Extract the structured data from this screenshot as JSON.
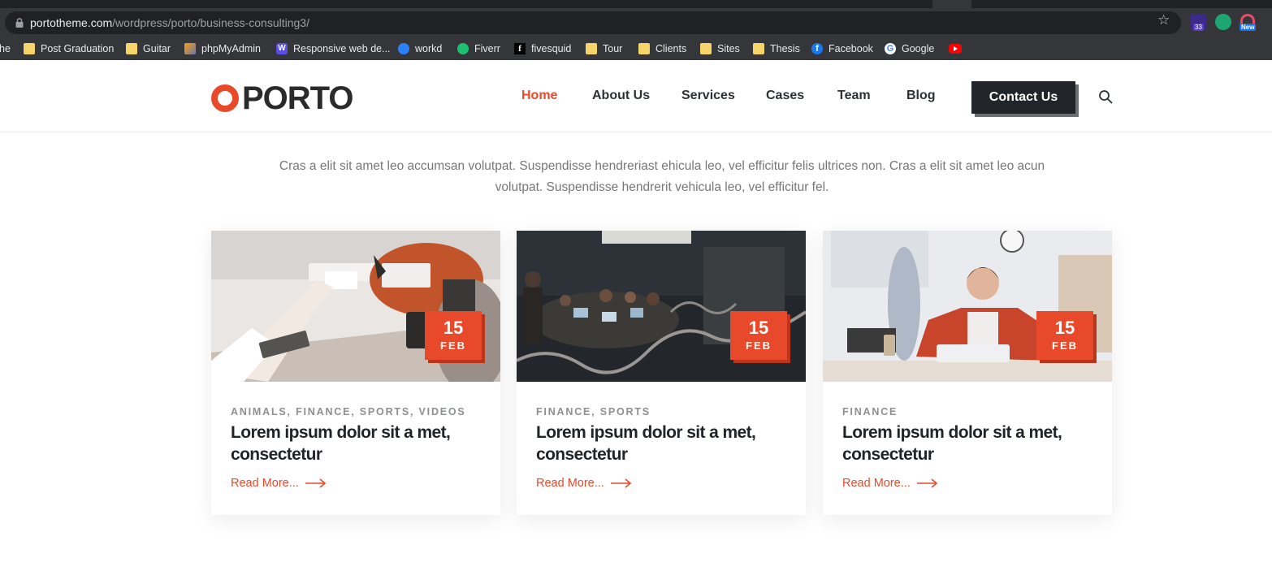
{
  "browser": {
    "url_host": "portotheme.com",
    "url_path": "/wordpress/porto/business-consulting3/",
    "ext_badge": "33",
    "ext_new": "New",
    "bookmarks": [
      {
        "label": "he",
        "icon": "none"
      },
      {
        "label": "Post Graduation",
        "icon": "folder-icon"
      },
      {
        "label": "Guitar",
        "icon": "folder-icon"
      },
      {
        "label": "phpMyAdmin",
        "icon": "phpmyadmin-icon"
      },
      {
        "label": "Responsive web de...",
        "icon": "webflow-icon"
      },
      {
        "label": "workd",
        "icon": "workd-icon"
      },
      {
        "label": "Fiverr",
        "icon": "fiverr-icon"
      },
      {
        "label": "fivesquid",
        "icon": "fivesquid-icon"
      },
      {
        "label": "Tour",
        "icon": "folder-icon"
      },
      {
        "label": "Clients",
        "icon": "folder-icon"
      },
      {
        "label": "Sites",
        "icon": "folder-icon"
      },
      {
        "label": "Thesis",
        "icon": "folder-icon"
      },
      {
        "label": "Facebook",
        "icon": "facebook-icon"
      },
      {
        "label": "Google",
        "icon": "google-icon"
      },
      {
        "label": "",
        "icon": "youtube-icon"
      }
    ]
  },
  "header": {
    "logo_text": "PORTO",
    "nav": [
      "Home",
      "About Us",
      "Services",
      "Cases",
      "Team",
      "Blog"
    ],
    "contact_label": "Contact Us"
  },
  "intro": "Cras a elit sit amet leo accumsan volutpat. Suspendisse hendreriast ehicula leo, vel efficitur felis ultrices non. Cras a elit sit amet leo acun volutpat. Suspendisse hendrerit vehicula leo, vel efficitur fel.",
  "posts": [
    {
      "day": "15",
      "month": "FEB",
      "categories": "ANIMALS, FINANCE, SPORTS, VIDEOS",
      "title": "Lorem ipsum dolor sit a met, consectetur",
      "read_more": "Read More..."
    },
    {
      "day": "15",
      "month": "FEB",
      "categories": "FINANCE, SPORTS",
      "title": "Lorem ipsum dolor sit a met, consectetur",
      "read_more": "Read More..."
    },
    {
      "day": "15",
      "month": "FEB",
      "categories": "FINANCE",
      "title": "Lorem ipsum dolor sit a met, consectetur",
      "read_more": "Read More..."
    }
  ],
  "colors": {
    "accent": "#e8492a",
    "dark": "#212529",
    "text_muted": "#777777"
  }
}
